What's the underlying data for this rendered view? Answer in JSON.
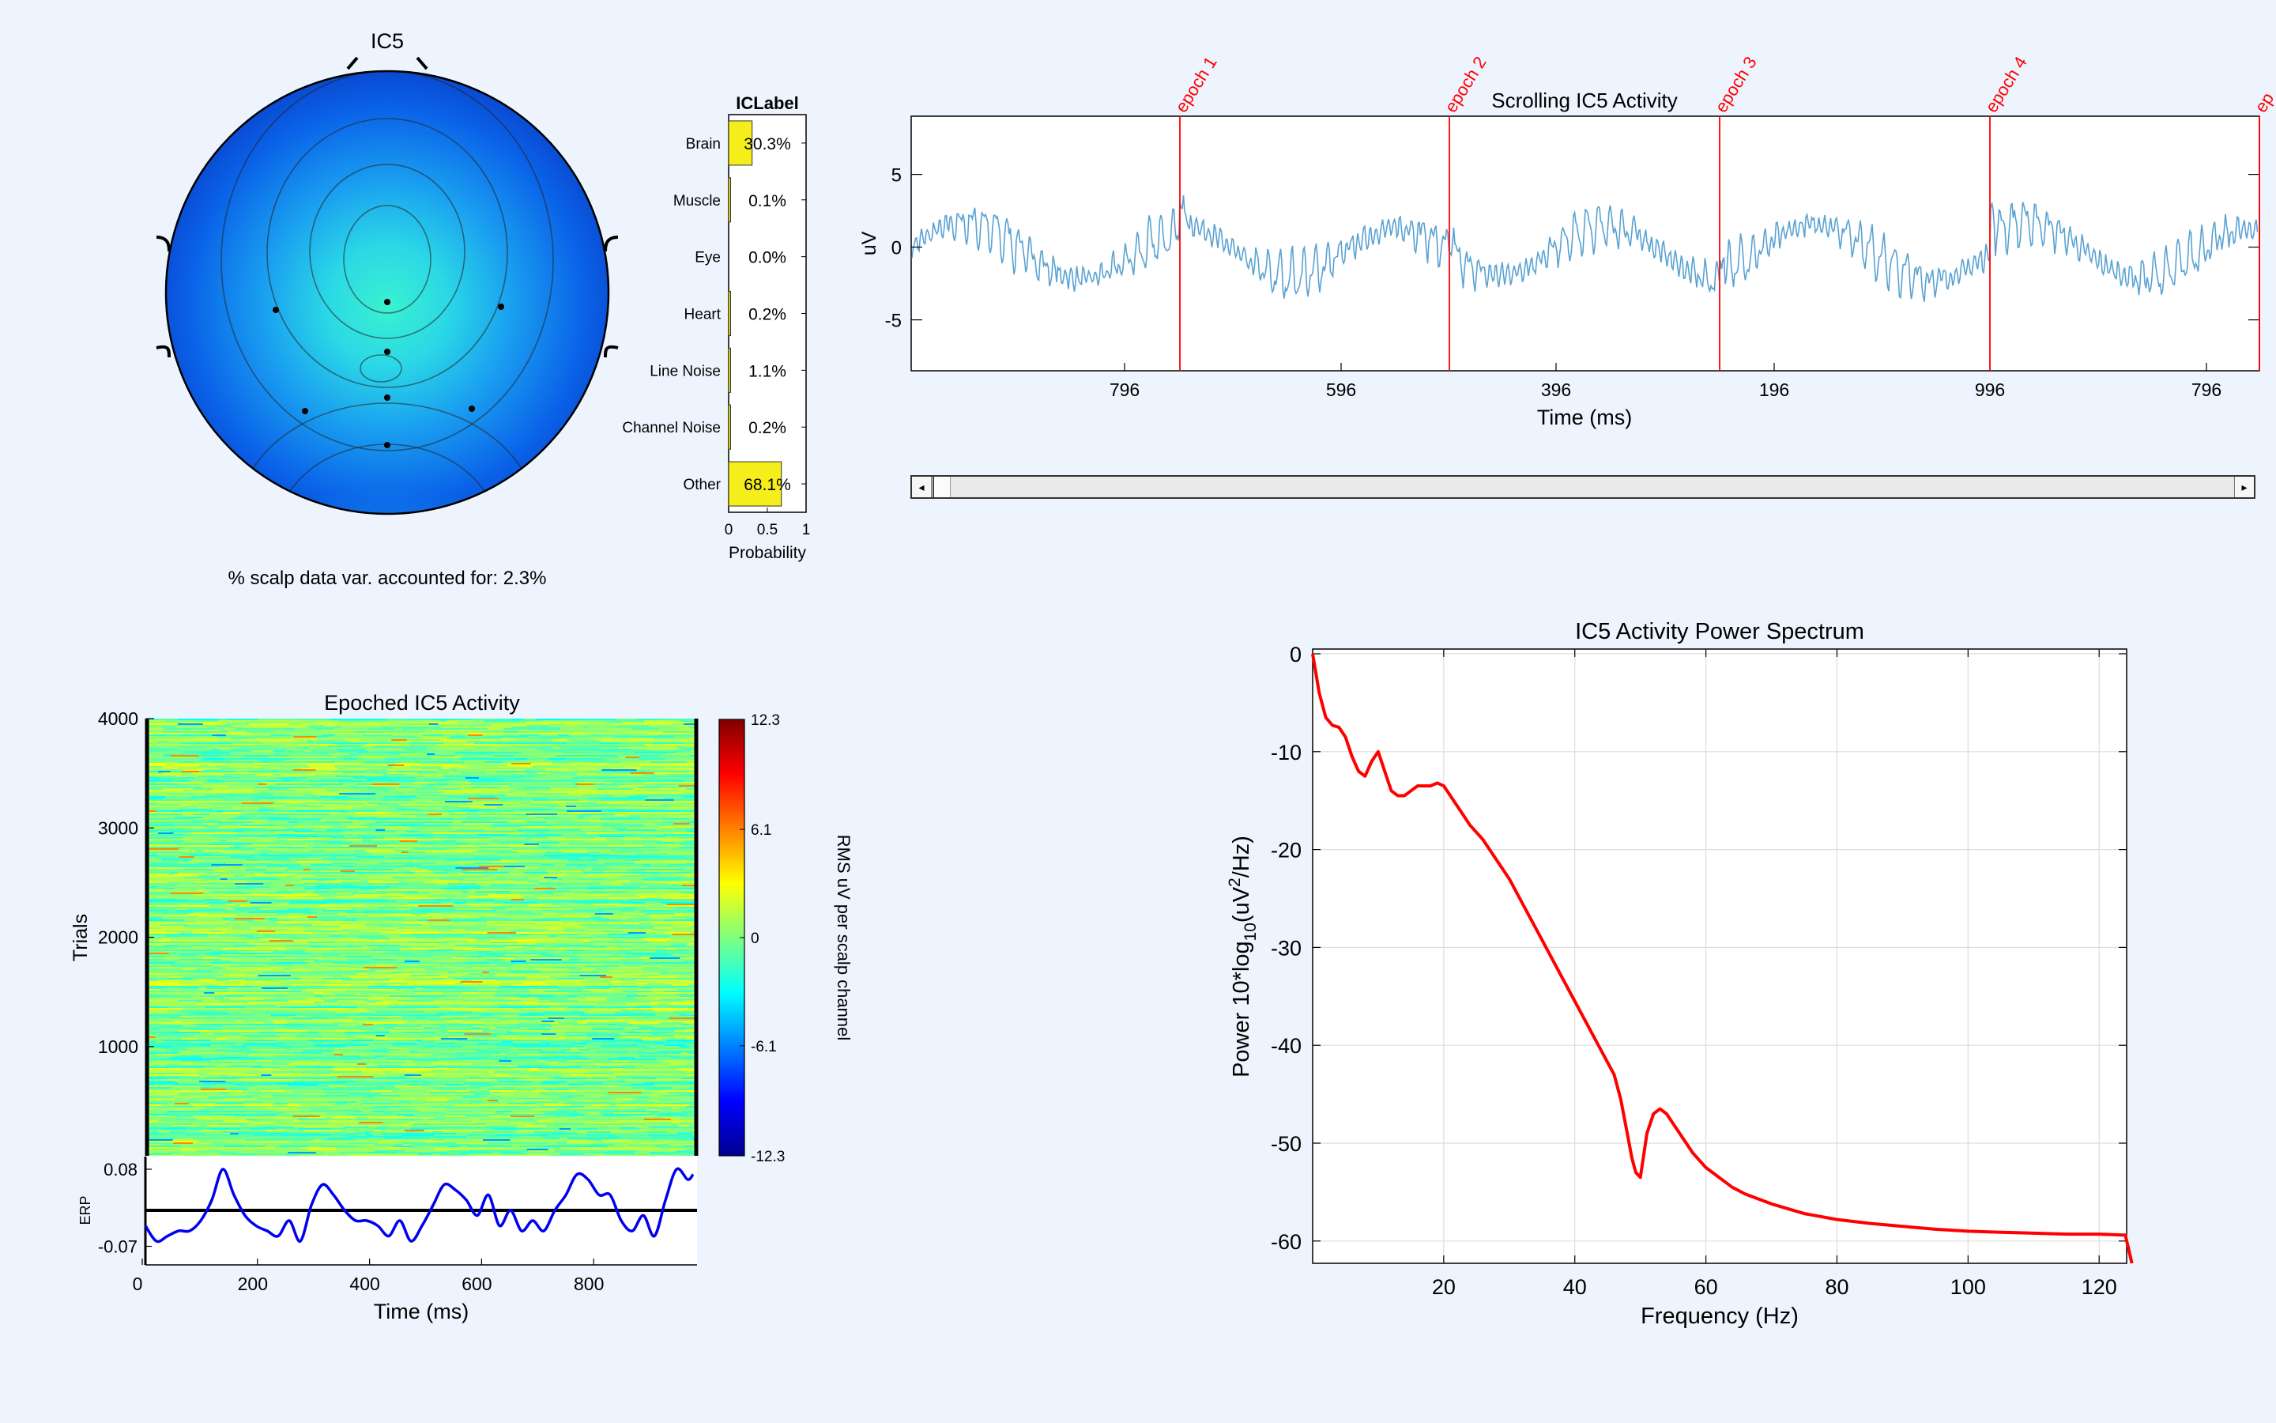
{
  "colors": {
    "background": "#edf4fd",
    "trace": "#5aa2d2",
    "epoch_marker": "#ff0000",
    "spectrum": "#ff0000",
    "erp": "#0000ee",
    "iclabel_bar": "#f5ee1a"
  },
  "scalp_map": {
    "title": "IC5",
    "variance_text": "% scalp data var. accounted for: 2.3%"
  },
  "icons": {
    "scroll_left": "◂",
    "scroll_right": "▸"
  },
  "chart_data": [
    {
      "id": "iclabel",
      "type": "bar",
      "orientation": "horizontal",
      "title": "ICLabel",
      "xlabel": "Probability",
      "xlim": [
        0,
        1
      ],
      "xticks": [
        "0",
        "0.5",
        "1"
      ],
      "categories": [
        "Brain",
        "Muscle",
        "Eye",
        "Heart",
        "Line Noise",
        "Channel Noise",
        "Other"
      ],
      "values": [
        0.303,
        0.001,
        0.0,
        0.002,
        0.011,
        0.002,
        0.681
      ],
      "labels": [
        "30.3%",
        "0.1%",
        "0.0%",
        "0.2%",
        "1.1%",
        "0.2%",
        "68.1%"
      ]
    },
    {
      "id": "scrolling",
      "type": "line",
      "title": "Scrolling IC5 Activity",
      "xlabel": "Time (ms)",
      "ylabel": "uV",
      "ylim": [
        -8.5,
        9
      ],
      "yticks": [
        "5",
        "0",
        "-5"
      ],
      "xticks": [
        "796",
        "596",
        "396",
        "196",
        "996",
        "796"
      ],
      "epoch_labels": [
        "epoch 1",
        "epoch 2",
        "epoch 3",
        "epoch 4",
        "ep"
      ]
    },
    {
      "id": "erpimage",
      "type": "heatmap",
      "title": "Epoched IC5 Activity",
      "ylabel": "Trials",
      "yticks": [
        "4000",
        "3000",
        "2000",
        "1000"
      ],
      "ylim": [
        1,
        4000
      ],
      "colorbar_label": "RMS uV per scalp channel",
      "colorbar_ticks": [
        "12.3",
        "6.1",
        "0",
        "-6.1",
        "-12.3"
      ],
      "clim": [
        -12.3,
        12.3
      ]
    },
    {
      "id": "erp",
      "type": "line",
      "ylabel": "ERP",
      "yticks": [
        "0.08",
        "-0.07"
      ],
      "xlabel": "Time (ms)",
      "xlim": [
        0,
        1000
      ],
      "xticks": [
        "0",
        "200",
        "400",
        "600",
        "800"
      ],
      "x": [
        0,
        20,
        40,
        60,
        80,
        100,
        120,
        140,
        160,
        180,
        200,
        220,
        240,
        260,
        280,
        300,
        320,
        340,
        360,
        380,
        400,
        420,
        440,
        460,
        480,
        500,
        520,
        540,
        560,
        580,
        600,
        620,
        640,
        660,
        680,
        700,
        720,
        740,
        760,
        780,
        800,
        820,
        840,
        860,
        880,
        900,
        920,
        940,
        960,
        980,
        990
      ],
      "values": [
        -0.03,
        -0.06,
        -0.05,
        -0.04,
        -0.04,
        -0.02,
        0.02,
        0.08,
        0.03,
        -0.01,
        -0.03,
        -0.04,
        -0.05,
        -0.02,
        -0.06,
        0.01,
        0.05,
        0.03,
        0.0,
        -0.02,
        -0.02,
        -0.03,
        -0.05,
        -0.02,
        -0.06,
        -0.03,
        0.01,
        0.05,
        0.04,
        0.02,
        -0.01,
        0.03,
        -0.03,
        0.0,
        -0.04,
        -0.02,
        -0.04,
        0.0,
        0.03,
        0.07,
        0.06,
        0.03,
        0.03,
        -0.02,
        -0.04,
        -0.01,
        -0.05,
        0.02,
        0.08,
        0.06,
        0.07
      ]
    },
    {
      "id": "spectrum",
      "type": "line",
      "title": "IC5 Activity Power Spectrum",
      "xlabel": "Frequency (Hz)",
      "ylabel": "Power 10*log10(uV2/Hz)",
      "xlim": [
        0,
        125
      ],
      "ylim": [
        -62.5,
        0
      ],
      "xticks": [
        20,
        40,
        60,
        80,
        100,
        120
      ],
      "yticks": [
        0,
        -10,
        -20,
        -30,
        -40,
        -50,
        -60
      ],
      "x": [
        0,
        1,
        2,
        3,
        4,
        5,
        6,
        7,
        8,
        9,
        10,
        11,
        12,
        13,
        14,
        15,
        16,
        17,
        18,
        19,
        20,
        22,
        24,
        26,
        28,
        30,
        32,
        34,
        36,
        38,
        40,
        42,
        44,
        46,
        47,
        48,
        48.7,
        49.3,
        50,
        51,
        52,
        53,
        54,
        56,
        58,
        60,
        62,
        64,
        66,
        70,
        75,
        80,
        85,
        90,
        95,
        100,
        105,
        110,
        115,
        120,
        124,
        125
      ],
      "values": [
        0,
        -4,
        -6.5,
        -7.3,
        -7.5,
        -8.5,
        -10.5,
        -12,
        -12.5,
        -11,
        -10,
        -12,
        -14,
        -14.5,
        -14.5,
        -14,
        -13.5,
        -13.5,
        -13.5,
        -13.2,
        -13.5,
        -15.5,
        -17.5,
        -19,
        -21,
        -23,
        -25.5,
        -28,
        -30.5,
        -33,
        -35.5,
        -38,
        -40.5,
        -43,
        -45.5,
        -49,
        -51.5,
        -53,
        -53.5,
        -49,
        -47,
        -46.5,
        -47,
        -49,
        -51,
        -52.5,
        -53.5,
        -54.5,
        -55.2,
        -56.2,
        -57.2,
        -57.8,
        -58.2,
        -58.5,
        -58.8,
        -59,
        -59.1,
        -59.2,
        -59.3,
        -59.3,
        -59.4,
        -62.5
      ]
    }
  ]
}
